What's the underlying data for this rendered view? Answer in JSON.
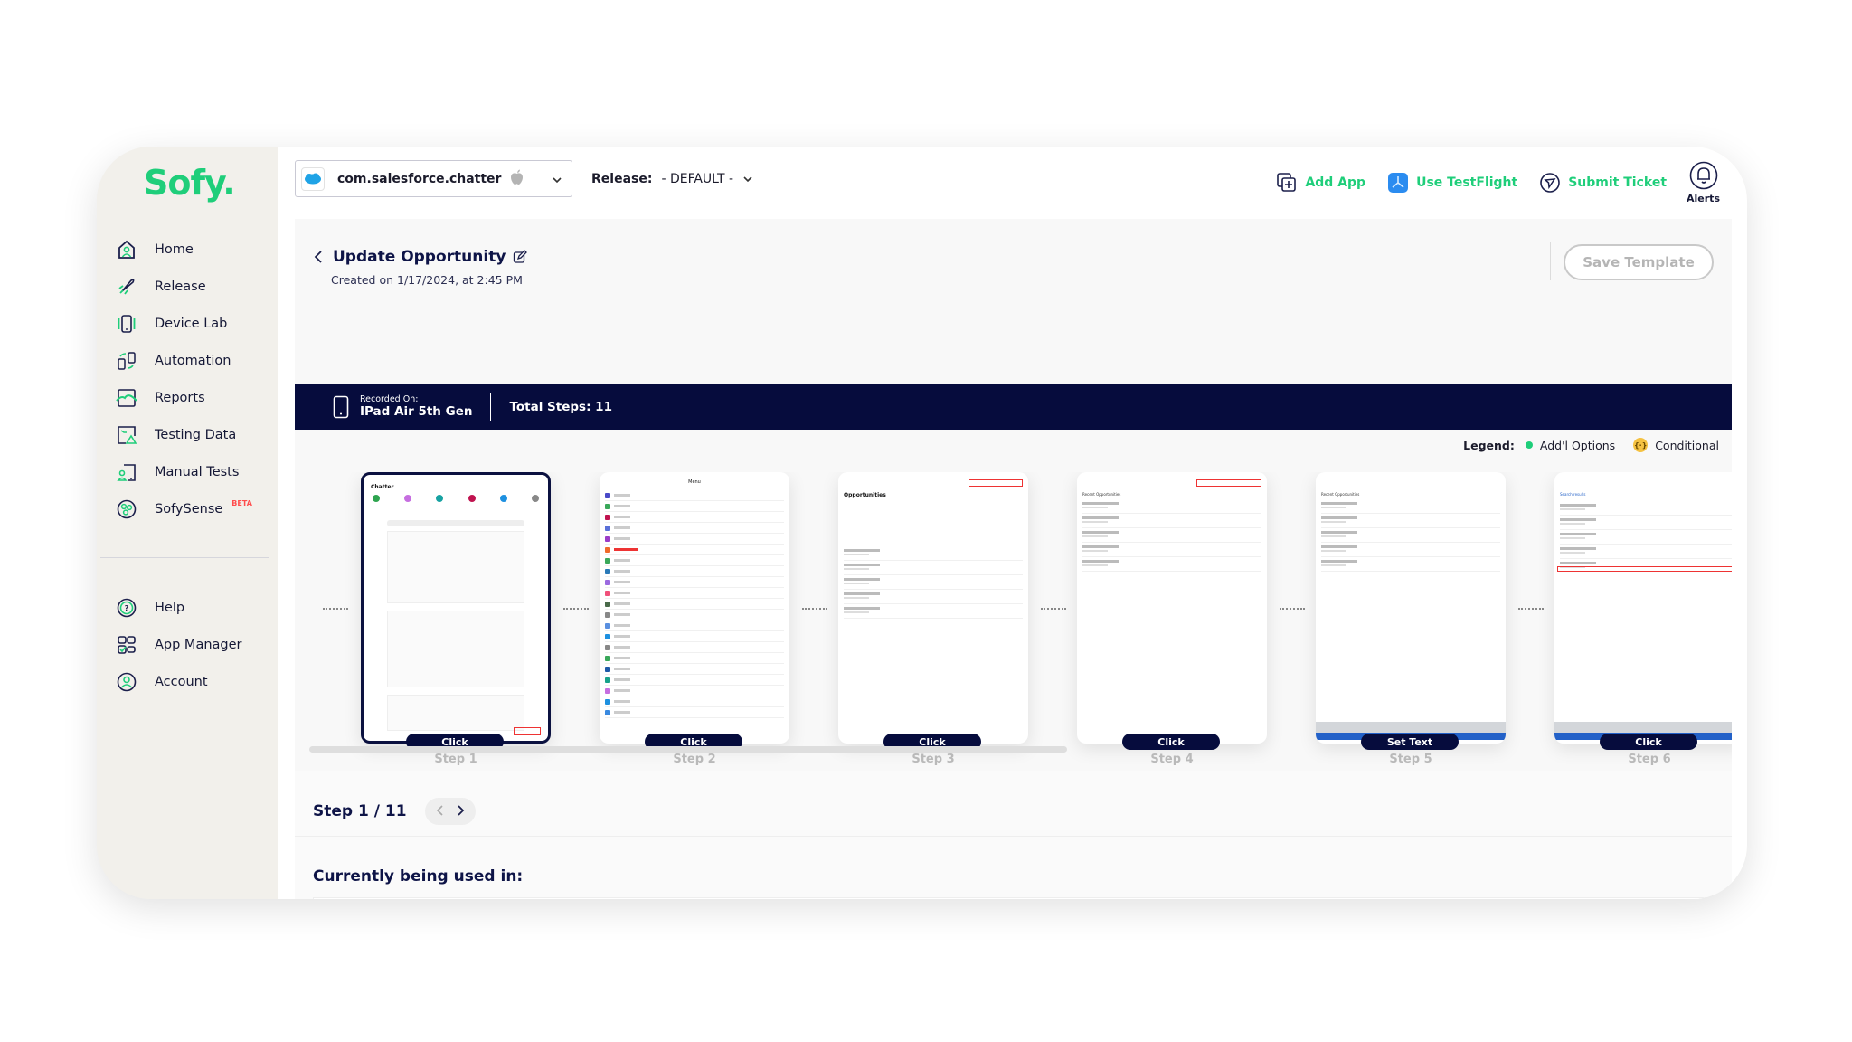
{
  "brand": {
    "logo_text": "Sofy.",
    "accent_color": "#1fce7a",
    "dark_color": "#060c3d"
  },
  "sidebar": {
    "items": [
      {
        "label": "Home",
        "icon": "home-icon"
      },
      {
        "label": "Release",
        "icon": "rocket-icon"
      },
      {
        "label": "Device Lab",
        "icon": "device-icon"
      },
      {
        "label": "Automation",
        "icon": "automation-icon"
      },
      {
        "label": "Reports",
        "icon": "reports-icon"
      },
      {
        "label": "Testing Data",
        "icon": "testing-data-icon"
      },
      {
        "label": "Manual Tests",
        "icon": "manual-tests-icon"
      },
      {
        "label": "SofySense",
        "icon": "sofysense-icon",
        "badge": "BETA"
      }
    ],
    "bottom_items": [
      {
        "label": "Help",
        "icon": "help-icon"
      },
      {
        "label": "App Manager",
        "icon": "app-manager-icon"
      },
      {
        "label": "Account",
        "icon": "account-icon"
      }
    ]
  },
  "header": {
    "app_select": {
      "value": "com.salesforce.chatter",
      "platform": "apple-icon"
    },
    "release": {
      "label": "Release:",
      "value": "- DEFAULT -"
    },
    "actions": [
      {
        "label": "Add App",
        "icon": "add-app-icon"
      },
      {
        "label": "Use TestFlight",
        "icon": "testflight-icon"
      },
      {
        "label": "Submit Ticket",
        "icon": "send-icon"
      }
    ],
    "alerts_label": "Alerts"
  },
  "template": {
    "title": "Update Opportunity",
    "created": "Created on 1/17/2024, at 2:45 PM",
    "save_label": "Save Template"
  },
  "banner": {
    "recorded_on_label": "Recorded On:",
    "device": "IPad Air 5th Gen",
    "total_steps": "Total Steps: 11"
  },
  "legend": {
    "label": "Legend:",
    "items": [
      {
        "label": "Add'l Options",
        "color": "#1fce7a"
      },
      {
        "label": "Conditional",
        "color": "#f5c242"
      }
    ]
  },
  "steps": [
    {
      "label": "Step 1",
      "action": "Click",
      "screen": "Chatter",
      "selected": true
    },
    {
      "label": "Step 2",
      "action": "Click",
      "screen": "Menu",
      "selected": false
    },
    {
      "label": "Step 3",
      "action": "Click",
      "screen": "Opportunities",
      "selected": false
    },
    {
      "label": "Step 4",
      "action": "Click",
      "screen": "Recent Opportunities",
      "selected": false
    },
    {
      "label": "Step 5",
      "action": "Set Text",
      "screen": "Recent Opportunities",
      "selected": false
    },
    {
      "label": "Step 6",
      "action": "Click",
      "screen": "Search results",
      "selected": false
    }
  ],
  "step_nav": {
    "text": "Step 1 / 11",
    "current": 1,
    "total": 11
  },
  "used_in": {
    "heading": "Currently being used in:"
  }
}
